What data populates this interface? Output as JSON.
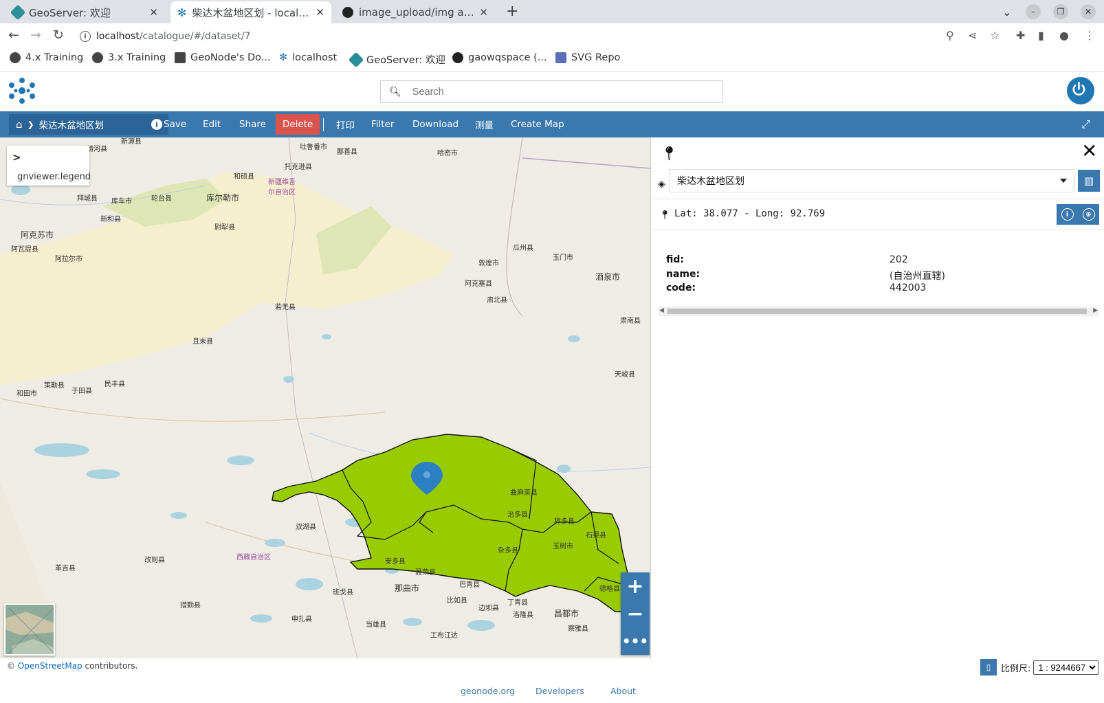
{
  "browser": {
    "tabs": [
      {
        "title": "GeoServer: 欢迎"
      },
      {
        "title": "柴达木盆地区划 - localhost"
      },
      {
        "title": "image_upload/img at main"
      }
    ],
    "url_host": "localhost",
    "url_path": "/catalogue/#/dataset/7",
    "bookmarks": [
      {
        "label": "4.x Training"
      },
      {
        "label": "3.x Training"
      },
      {
        "label": "GeoNode's Do..."
      },
      {
        "label": "localhost"
      },
      {
        "label": "GeoServer: 欢迎"
      },
      {
        "label": "gaowqspace (..."
      },
      {
        "label": "SVG Repo"
      }
    ]
  },
  "header": {
    "search_placeholder": "Search"
  },
  "toolbar": {
    "breadcrumb": "柴达木盆地区划",
    "buttons": {
      "save": "Save",
      "edit": "Edit",
      "share": "Share",
      "delete": "Delete",
      "print": "打印",
      "filter": "Filter",
      "download": "Download",
      "measure": "测量",
      "create_map": "Create Map"
    }
  },
  "map": {
    "legend_label": "gnviewer.legend",
    "polygon_color": "#99cc00",
    "labels": [
      "吐鲁番市",
      "鄯善县",
      "哈密市",
      "托克逊县",
      "和硕县",
      "新疆维吾尔自治区",
      "拜城县",
      "库车市",
      "轮台县",
      "库尔勒市",
      "阿克苏市",
      "新和县",
      "尉犁县",
      "阿瓦提县",
      "阿拉尔市",
      "瓜州县",
      "玉门市",
      "敦煌市",
      "酒泉市",
      "阿克塞县",
      "肃北县",
      "若羌县",
      "且末县",
      "肃南县",
      "民丰县",
      "策勒县",
      "于田县",
      "和田市",
      "天峻县",
      "曲麻莱县",
      "治多县",
      "称多县",
      "石渠县",
      "双湖县",
      "玉树市",
      "杂多县",
      "西藏自治区",
      "改则县",
      "革吉县",
      "安多县",
      "聂荣县",
      "巴青县",
      "那曲市",
      "班戈县",
      "比如县",
      "丁青县",
      "边坝县",
      "洛隆县",
      "昌都市",
      "措勤县",
      "申扎县",
      "当雄县",
      "工布江达",
      "察雅县",
      "德格县",
      "新源县",
      "精河县"
    ]
  },
  "identify": {
    "layer": "柴达木盆地区划",
    "coordinates": "Lat: 38.077 - Long: 92.769",
    "attributes": [
      {
        "key": "fid:",
        "value": "202"
      },
      {
        "key": "name:",
        "value": "(自治州直辖)"
      },
      {
        "key": "code:",
        "value": "442003"
      }
    ]
  },
  "footer": {
    "attribution_prefix": "©",
    "attribution_link": "OpenStreetMap",
    "attribution_suffix": "contributors.",
    "scale_label": "比例尺:",
    "scale_value": "1 : 9244667",
    "links": [
      "geonode.org",
      "Developers",
      "About"
    ]
  }
}
